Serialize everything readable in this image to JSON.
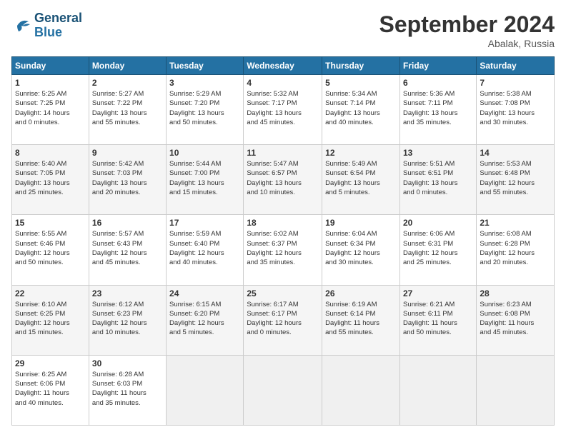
{
  "header": {
    "logo_line1": "General",
    "logo_line2": "Blue",
    "month": "September 2024",
    "location": "Abalak, Russia"
  },
  "weekdays": [
    "Sunday",
    "Monday",
    "Tuesday",
    "Wednesday",
    "Thursday",
    "Friday",
    "Saturday"
  ],
  "weeks": [
    [
      {
        "day": "1",
        "info": "Sunrise: 5:25 AM\nSunset: 7:25 PM\nDaylight: 14 hours\nand 0 minutes."
      },
      {
        "day": "2",
        "info": "Sunrise: 5:27 AM\nSunset: 7:22 PM\nDaylight: 13 hours\nand 55 minutes."
      },
      {
        "day": "3",
        "info": "Sunrise: 5:29 AM\nSunset: 7:20 PM\nDaylight: 13 hours\nand 50 minutes."
      },
      {
        "day": "4",
        "info": "Sunrise: 5:32 AM\nSunset: 7:17 PM\nDaylight: 13 hours\nand 45 minutes."
      },
      {
        "day": "5",
        "info": "Sunrise: 5:34 AM\nSunset: 7:14 PM\nDaylight: 13 hours\nand 40 minutes."
      },
      {
        "day": "6",
        "info": "Sunrise: 5:36 AM\nSunset: 7:11 PM\nDaylight: 13 hours\nand 35 minutes."
      },
      {
        "day": "7",
        "info": "Sunrise: 5:38 AM\nSunset: 7:08 PM\nDaylight: 13 hours\nand 30 minutes."
      }
    ],
    [
      {
        "day": "8",
        "info": "Sunrise: 5:40 AM\nSunset: 7:05 PM\nDaylight: 13 hours\nand 25 minutes."
      },
      {
        "day": "9",
        "info": "Sunrise: 5:42 AM\nSunset: 7:03 PM\nDaylight: 13 hours\nand 20 minutes."
      },
      {
        "day": "10",
        "info": "Sunrise: 5:44 AM\nSunset: 7:00 PM\nDaylight: 13 hours\nand 15 minutes."
      },
      {
        "day": "11",
        "info": "Sunrise: 5:47 AM\nSunset: 6:57 PM\nDaylight: 13 hours\nand 10 minutes."
      },
      {
        "day": "12",
        "info": "Sunrise: 5:49 AM\nSunset: 6:54 PM\nDaylight: 13 hours\nand 5 minutes."
      },
      {
        "day": "13",
        "info": "Sunrise: 5:51 AM\nSunset: 6:51 PM\nDaylight: 13 hours\nand 0 minutes."
      },
      {
        "day": "14",
        "info": "Sunrise: 5:53 AM\nSunset: 6:48 PM\nDaylight: 12 hours\nand 55 minutes."
      }
    ],
    [
      {
        "day": "15",
        "info": "Sunrise: 5:55 AM\nSunset: 6:46 PM\nDaylight: 12 hours\nand 50 minutes."
      },
      {
        "day": "16",
        "info": "Sunrise: 5:57 AM\nSunset: 6:43 PM\nDaylight: 12 hours\nand 45 minutes."
      },
      {
        "day": "17",
        "info": "Sunrise: 5:59 AM\nSunset: 6:40 PM\nDaylight: 12 hours\nand 40 minutes."
      },
      {
        "day": "18",
        "info": "Sunrise: 6:02 AM\nSunset: 6:37 PM\nDaylight: 12 hours\nand 35 minutes."
      },
      {
        "day": "19",
        "info": "Sunrise: 6:04 AM\nSunset: 6:34 PM\nDaylight: 12 hours\nand 30 minutes."
      },
      {
        "day": "20",
        "info": "Sunrise: 6:06 AM\nSunset: 6:31 PM\nDaylight: 12 hours\nand 25 minutes."
      },
      {
        "day": "21",
        "info": "Sunrise: 6:08 AM\nSunset: 6:28 PM\nDaylight: 12 hours\nand 20 minutes."
      }
    ],
    [
      {
        "day": "22",
        "info": "Sunrise: 6:10 AM\nSunset: 6:25 PM\nDaylight: 12 hours\nand 15 minutes."
      },
      {
        "day": "23",
        "info": "Sunrise: 6:12 AM\nSunset: 6:23 PM\nDaylight: 12 hours\nand 10 minutes."
      },
      {
        "day": "24",
        "info": "Sunrise: 6:15 AM\nSunset: 6:20 PM\nDaylight: 12 hours\nand 5 minutes."
      },
      {
        "day": "25",
        "info": "Sunrise: 6:17 AM\nSunset: 6:17 PM\nDaylight: 12 hours\nand 0 minutes."
      },
      {
        "day": "26",
        "info": "Sunrise: 6:19 AM\nSunset: 6:14 PM\nDaylight: 11 hours\nand 55 minutes."
      },
      {
        "day": "27",
        "info": "Sunrise: 6:21 AM\nSunset: 6:11 PM\nDaylight: 11 hours\nand 50 minutes."
      },
      {
        "day": "28",
        "info": "Sunrise: 6:23 AM\nSunset: 6:08 PM\nDaylight: 11 hours\nand 45 minutes."
      }
    ],
    [
      {
        "day": "29",
        "info": "Sunrise: 6:25 AM\nSunset: 6:06 PM\nDaylight: 11 hours\nand 40 minutes."
      },
      {
        "day": "30",
        "info": "Sunrise: 6:28 AM\nSunset: 6:03 PM\nDaylight: 11 hours\nand 35 minutes."
      },
      {
        "day": "",
        "info": ""
      },
      {
        "day": "",
        "info": ""
      },
      {
        "day": "",
        "info": ""
      },
      {
        "day": "",
        "info": ""
      },
      {
        "day": "",
        "info": ""
      }
    ]
  ]
}
